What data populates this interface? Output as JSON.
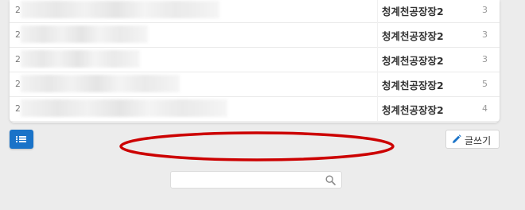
{
  "posts": [
    {
      "num": "2",
      "author": "청계천공장장2",
      "count": "3"
    },
    {
      "num": "2",
      "author": "청계천공장장2",
      "count": "3"
    },
    {
      "num": "2",
      "author": "청계천공장장2",
      "count": "3"
    },
    {
      "num": "2",
      "author": "청계천공장장2",
      "count": "5"
    },
    {
      "num": "2",
      "author": "청계천공장장2",
      "count": "4"
    }
  ],
  "toolbar": {
    "list_icon": "list-icon",
    "write_icon": "pencil-icon",
    "write_label": "글쓰기"
  },
  "search": {
    "placeholder": "",
    "icon": "search-icon"
  },
  "colors": {
    "accent": "#1a73c8",
    "annotation": "#cc0000"
  }
}
